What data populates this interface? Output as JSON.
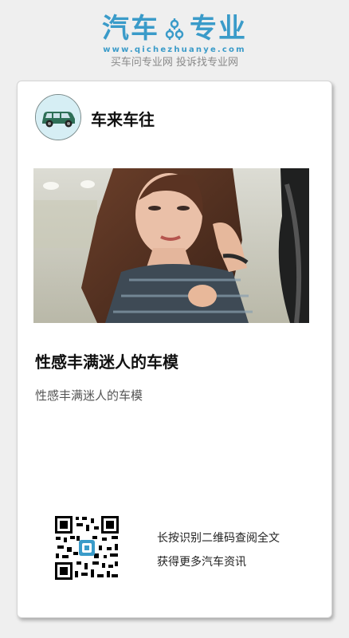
{
  "brand": {
    "title_left": "汽车",
    "title_right": "专业",
    "url": "www.qichezhuanye.com",
    "slogan": "买车问专业网 投诉找专业网",
    "color": "#3a9bc9",
    "gear_icon": "gear-icon"
  },
  "author": {
    "name": "车来车往",
    "avatar_icon": "car-icon"
  },
  "article": {
    "title": "性感丰满迷人的车模",
    "description": "性感丰满迷人的车模"
  },
  "footer": {
    "qr_icon": "qr-code-icon",
    "line1": "长按识别二维码查阅全文",
    "line2": "获得更多汽车资讯"
  }
}
